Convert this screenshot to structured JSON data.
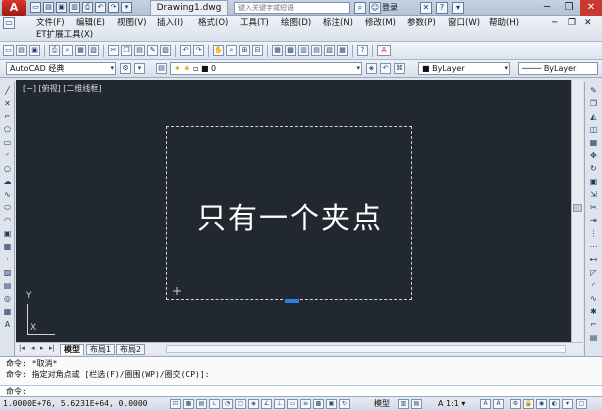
{
  "titlebar": {
    "app_button": "A",
    "document_title": "Drawing1.dwg",
    "search_placeholder": "键入关键字或短语",
    "login_label": "登录",
    "window_controls": {
      "minimize": "─",
      "restore": "❐",
      "close": "✕"
    },
    "doc_controls": {
      "minimize": "─",
      "restore": "❐",
      "close": "✕"
    }
  },
  "menubar": {
    "items": [
      "文件(F)",
      "编辑(E)",
      "视图(V)",
      "插入(I)",
      "格式(O)",
      "工具(T)",
      "绘图(D)",
      "标注(N)",
      "修改(M)",
      "参数(P)",
      "窗口(W)",
      "帮助(H)"
    ],
    "row2_item": "ET扩展工具(X)"
  },
  "toolbar2": {
    "workspace": "AutoCAD 经典",
    "layer_value": "0",
    "color_value": "ByLayer",
    "linetype_value": "ByLayer"
  },
  "viewport": {
    "label": "[−] [俯视] [二维线框]",
    "center_text": "只有一个夹点",
    "ucs_y": "Y",
    "ucs_x": "X"
  },
  "layout_tabs": [
    "模型",
    "布局1",
    "布局2"
  ],
  "command": {
    "line1": "命令: *取消*",
    "line2": "命令: 指定对角点或 [栏选(F)/圈围(WP)/圈交(CP)]:",
    "prompt": "命令:"
  },
  "statusbar": {
    "coords": "1.0000E+76, 5.6231E+64, 0.0000",
    "model_label": "模型",
    "scale_label": "A 1:1 ▾"
  },
  "colors": {
    "canvas": "#212830",
    "grip": "#2d7fe0",
    "chrome": "#dfe4ec"
  }
}
